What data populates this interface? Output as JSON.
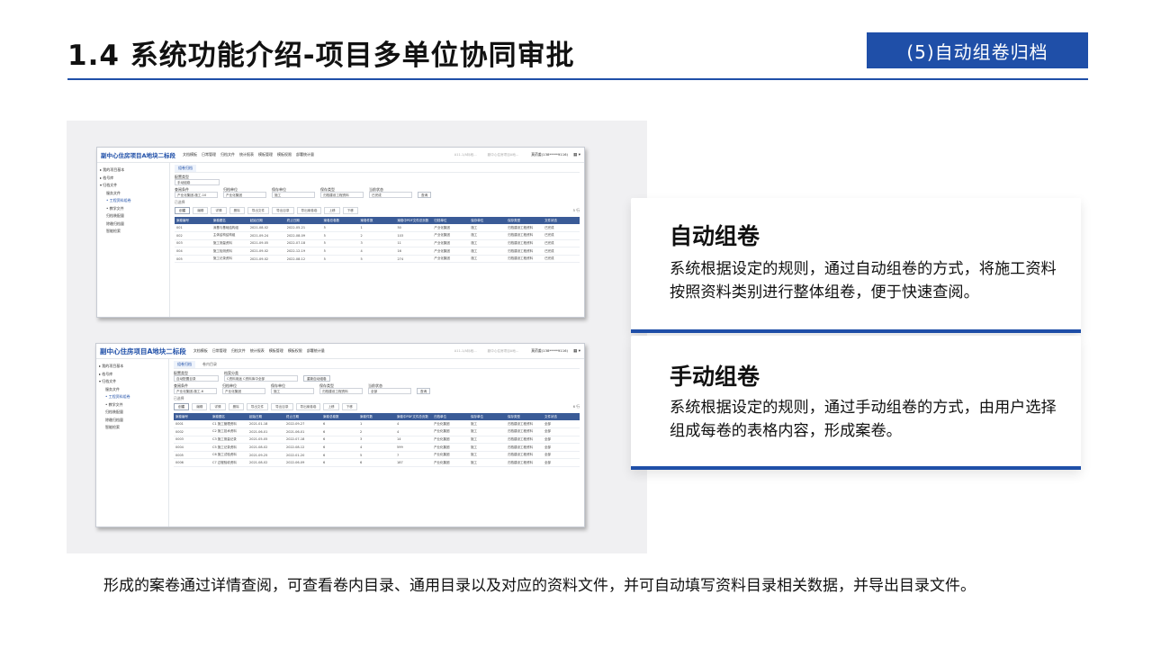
{
  "header": {
    "title": "1.4 系统功能介绍-项目多单位协同审批",
    "section_tag": "(5)自动组卷归档"
  },
  "app": {
    "logo": "副中心住房项目A地块二标段",
    "nav": [
      "文档模板",
      "日常管理",
      "归档文件",
      "统计报表",
      "模板管理",
      "模板权限",
      "部署统计量"
    ],
    "search_placeholders": [
      "A11-1/A标段...",
      "副中心住房项目A地..."
    ],
    "user": "莫药姜(138*****9116)",
    "sidebar": [
      {
        "label": "▸ 我的项目基本",
        "type": "top"
      },
      {
        "label": "▸ 档号库",
        "type": "top"
      },
      {
        "label": "▾ 归档文件",
        "type": "top"
      },
      {
        "label": "服务文件",
        "type": "sub"
      },
      {
        "label": "• 工程资料组卷",
        "type": "sub"
      },
      {
        "label": "• 教学文件",
        "type": "sub"
      },
      {
        "label": "归档装配量",
        "type": "sub"
      },
      {
        "label": "除缴归档量",
        "type": "sub"
      },
      {
        "label": "智能检索",
        "type": "sub"
      }
    ]
  },
  "shot1": {
    "tabs": [
      "组卷归档"
    ],
    "config_label": "配置类型",
    "config_value": "手动组卷",
    "filters": [
      {
        "label": "查阅条件",
        "value": "产业化集团-施工-10"
      },
      {
        "label": "归档单位",
        "value": "产业化集团"
      },
      {
        "label": "保存单位",
        "value": "施工"
      },
      {
        "label": "保存类型",
        "value": "归档建设工程资料"
      },
      {
        "label": "当前状态",
        "value": "已完成"
      }
    ],
    "search_btn": "查询",
    "selected": "已选择",
    "toolbar": [
      "创建",
      "编辑",
      "详情",
      "删除",
      "导出文件",
      "导出目录",
      "导出案卷卷"
    ],
    "toolbar_extra": [
      "上移",
      "下移"
    ],
    "count": "5 行",
    "columns": [
      "案卷编号",
      "案卷题名",
      "起始日期",
      "终止日期",
      "案卷总卷数",
      "案卷件数",
      "案卷中PDF文件总页数",
      "归档单位",
      "保存单位",
      "保存类型",
      "文件状态"
    ],
    "rows": [
      [
        "001",
        "深基与基础结构组",
        "2021-08-02",
        "2022-05-21",
        "5",
        "1",
        "50",
        "产业化集团",
        "施工",
        "归档建设工程资料",
        "已完成"
      ],
      [
        "002",
        "主体结构结构组",
        "2021-09-24",
        "2022-08-09",
        "5",
        "2",
        "103",
        "产业化集团",
        "施工",
        "归档建设工程资料",
        "已完成"
      ],
      [
        "003",
        "施工测量资料",
        "2021-09-05",
        "2022-07-18",
        "5",
        "3",
        "11",
        "产业化集团",
        "施工",
        "归档建设工程资料",
        "已完成"
      ],
      [
        "004",
        "施工检测资料",
        "2021-09-02",
        "2022-12-19",
        "5",
        "4",
        "16",
        "产业化集团",
        "施工",
        "归档建设工程资料",
        "已完成"
      ],
      [
        "005",
        "施工记录资料",
        "2021-09-02",
        "2022-08-12",
        "5",
        "5",
        "274",
        "产业化集团",
        "施工",
        "归档建设工程资料",
        "已完成"
      ]
    ]
  },
  "shot2": {
    "tabs": [
      "组卷归档",
      "卷内目录"
    ],
    "config_label": "配置类型",
    "config_value": "自动配置目录",
    "class_label": "档案分类",
    "class_value": "C资料用途 C资料库中全部",
    "auto_btn": "重新自动组卷",
    "filters": [
      {
        "label": "查阅条件",
        "value": "产业化集团-施工-6"
      },
      {
        "label": "归档单位",
        "value": "产业化集团"
      },
      {
        "label": "保存单位",
        "value": "施工"
      },
      {
        "label": "保存类型",
        "value": "归档建设工程资料"
      },
      {
        "label": "当前状态",
        "value": "全部"
      }
    ],
    "search_btn": "查询",
    "selected": "已选择",
    "toolbar": [
      "创建",
      "编辑",
      "详情",
      "删除",
      "导出文件",
      "导出目录",
      "导出案卷卷"
    ],
    "toolbar_extra": [
      "上移",
      "下移"
    ],
    "count": "6 行",
    "columns": [
      "案卷编号",
      "案卷题名",
      "起始日期",
      "终止日期",
      "案卷总卷数",
      "案卷件数",
      "案卷中PDF文件总页数",
      "归档单位",
      "保存单位",
      "保存类型",
      "文件状态"
    ],
    "rows": [
      [
        "0001",
        "C1 施工管理资料",
        "2021-01-18",
        "2022-09-27",
        "6",
        "1",
        "4",
        "产业化集团",
        "施工",
        "归档建设工程资料",
        "全部"
      ],
      [
        "0002",
        "C2 施工技术资料",
        "2021-06-01",
        "2021-06-01",
        "6",
        "2",
        "4",
        "产业化集团",
        "施工",
        "归档建设工程资料",
        "全部"
      ],
      [
        "0003",
        "C3 施工测量记录",
        "2021-05-05",
        "2022-07-18",
        "6",
        "3",
        "14",
        "产业化集团",
        "施工",
        "归档建设工程资料",
        "全部"
      ],
      [
        "0004",
        "C5 施工记录资料",
        "2021-08-02",
        "2022-08-12",
        "6",
        "4",
        "599",
        "产业化集团",
        "施工",
        "归档建设工程资料",
        "全部"
      ],
      [
        "0005",
        "C6 施工试验资料",
        "2021-09-25",
        "2022-01-20",
        "6",
        "5",
        "7",
        "产业化集团",
        "施工",
        "归档建设工程资料",
        "全部"
      ],
      [
        "0006",
        "C7 过程验收资料",
        "2021-08-02",
        "2022-06-09",
        "6",
        "6",
        "187",
        "产业化集团",
        "施工",
        "归档建设工程资料",
        "全部"
      ]
    ]
  },
  "cards": [
    {
      "title": "自动组卷",
      "text": "系统根据设定的规则，通过自动组卷的方式，将施工资料按照资料类别进行整体组卷，便于快速查阅。"
    },
    {
      "title": "手动组卷",
      "text": "系统根据设定的规则，通过手动组卷的方式，由用户选择组成每卷的表格内容，形成案卷。"
    }
  ],
  "caption": "形成的案卷通过详情查阅，可查看卷内目录、通用目录以及对应的资料文件，并可自动填写资料目录相关数据，并导出目录文件。",
  "colors": {
    "accent": "#1f4fa8",
    "table_header": "#3a5b97",
    "panel_bg": "#f0f0f2"
  }
}
